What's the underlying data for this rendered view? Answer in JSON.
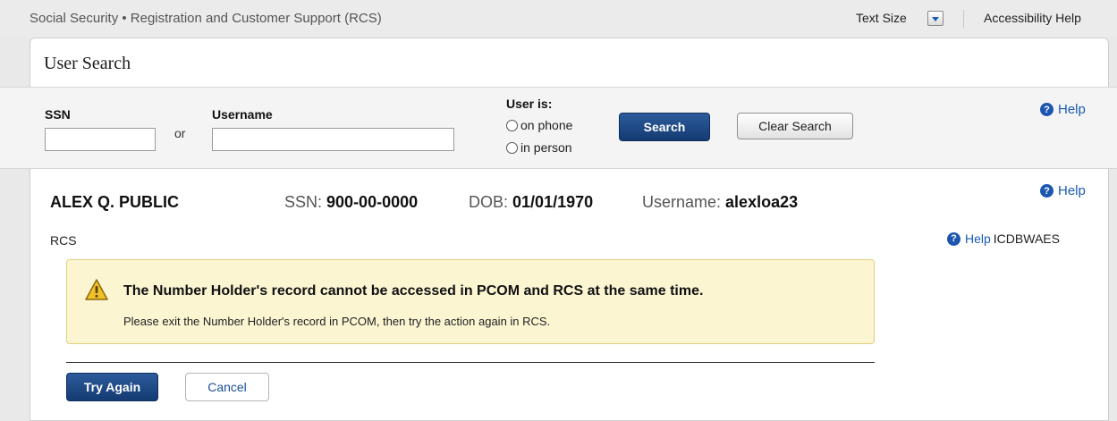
{
  "header": {
    "app_title": "Social Security • Registration and Customer Support (RCS)",
    "text_size_label": "Text Size",
    "accessibility_help": "Accessibility Help"
  },
  "panel": {
    "title": "User Search"
  },
  "search": {
    "ssn_label": "SSN",
    "ssn_value": "",
    "or_text": "or",
    "username_label": "Username",
    "username_value": "",
    "user_is_label": "User is:",
    "options": [
      "on phone",
      "in person"
    ],
    "search_button": "Search",
    "clear_button": "Clear Search",
    "help_label": "Help"
  },
  "user": {
    "name": "ALEX Q. PUBLIC",
    "ssn_label": "SSN:",
    "ssn": "900-00-0000",
    "dob_label": "DOB:",
    "dob": "01/01/1970",
    "username_label": "Username:",
    "username": "alexloa23",
    "help_label": "Help"
  },
  "rcs": {
    "label": "RCS",
    "help_label": "Help",
    "help_code": "ICDBWAES"
  },
  "alert": {
    "title": "The Number Holder's record cannot be accessed in PCOM and RCS at the same time.",
    "body": "Please exit the Number Holder's record in PCOM, then try the action again in RCS."
  },
  "actions": {
    "try_again": "Try Again",
    "cancel": "Cancel"
  },
  "colors": {
    "primary_button": "#143b72",
    "link": "#1a5bb5",
    "warning_bg": "#fbf5d2",
    "warning_border": "#e3cf7e"
  }
}
